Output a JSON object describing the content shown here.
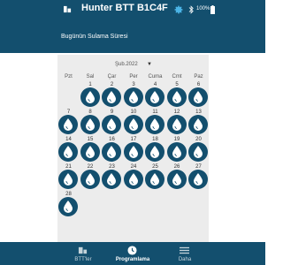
{
  "status_bar": {
    "battery_text": "100%"
  },
  "header": {
    "title": "Hunter BTT B1C4F",
    "section_title": "Bugünün Sulama Süresi"
  },
  "calendar": {
    "month_label": "Şub.2022",
    "weekdays": [
      "Pzt",
      "Sal",
      "Çar",
      "Per",
      "Cuma",
      "Cmt",
      "Paz"
    ],
    "days": [
      "1",
      "2",
      "3",
      "4",
      "5",
      "6",
      "7",
      "8",
      "9",
      "10",
      "11",
      "12",
      "13",
      "14",
      "15",
      "16",
      "17",
      "18",
      "19",
      "20",
      "21",
      "22",
      "23",
      "24",
      "25",
      "26",
      "27",
      "28"
    ],
    "first_weekday_index": 1
  },
  "bottom_nav": {
    "items": [
      {
        "label": "BTT'ler",
        "icon": "bluetooth-device-icon",
        "active": false
      },
      {
        "label": "Programlama",
        "icon": "clock-icon",
        "active": true
      },
      {
        "label": "Daha",
        "icon": "menu-icon",
        "active": false
      }
    ]
  },
  "colors": {
    "primary": "#134f6e",
    "panel_bg": "#ececec"
  }
}
